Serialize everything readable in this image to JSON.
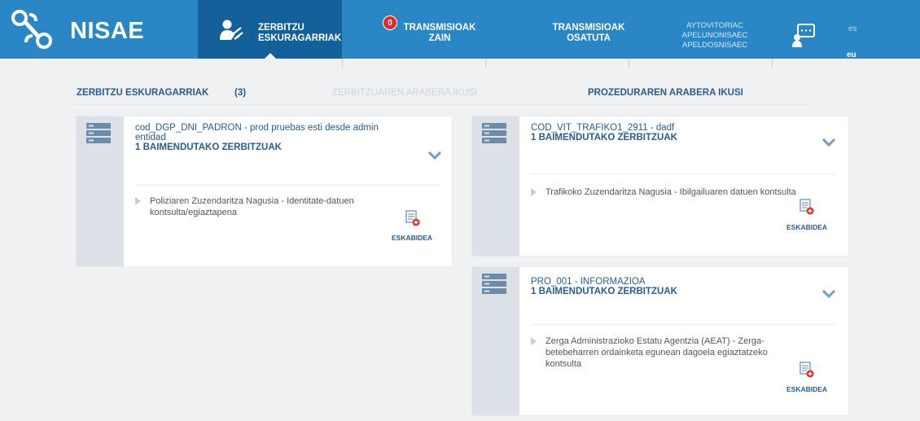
{
  "app": {
    "name": "NISAE"
  },
  "nav": {
    "active": {
      "label_line1": "ZERBITZU",
      "label_line2": "ESKURAGARRIAK"
    },
    "trans_zain": {
      "label_line1": "TRANSMISIOAK",
      "label_line2": "ZAIN",
      "badge": "0"
    },
    "trans_osat": {
      "label_line1": "TRANSMISIOAK",
      "label_line2": "OSATUTA"
    }
  },
  "user": {
    "line1": "AYTOVITORIAC",
    "line2": "APELUNONISAEC",
    "line3": "APELDOSNISAEC"
  },
  "lang": {
    "es": "es",
    "eu": "eu"
  },
  "subheader": {
    "title": "ZERBITZU ESKURAGARRIAK",
    "count": "(3)",
    "by_service": "ZERBITZUAREN ARABERA IKUSI",
    "by_procedure": "PROZEDURAREN ARABERA IKUSI"
  },
  "cards": [
    {
      "title_line1": "cod_DGP_DNI_PADRON - prod pruebas esti desde admin",
      "title_line2": "entidad",
      "subtitle": "1 BAIMENDUTAKO ZERBITZUAK",
      "item_line1": "Poliziaren Zuzendaritza Nagusia - Identitate-datuen",
      "item_line2": "kontsulta/egiaztapena",
      "action": "ESKABIDEA"
    },
    {
      "title_line1": "COD_VIT_TRAFIKO1_2911 - dadf",
      "subtitle": "1 BAIMENDUTAKO ZERBITZUAK",
      "item_line1": "Trafikoko Zuzendaritza Nagusia - Ibilgailuaren datuen kontsulta",
      "action": "ESKABIDEA"
    },
    {
      "title_line1": "PRO_001 - INFORMAZIOA",
      "subtitle": "1 BAIMENDUTAKO ZERBITZUAK",
      "item_line1": "Zerga Administrazioko Estatu Agentzia (AEAT) - Zerga-",
      "item_line2": "betebeharren ordainketa egunean dagoela egiaztatzeko",
      "item_line3": "kontsulta",
      "action": "ESKABIDEA"
    }
  ],
  "colors": {
    "header": "#2a86c4",
    "header_active": "#14609a",
    "accent": "#2a5c8c",
    "badge": "#e02b2b"
  }
}
